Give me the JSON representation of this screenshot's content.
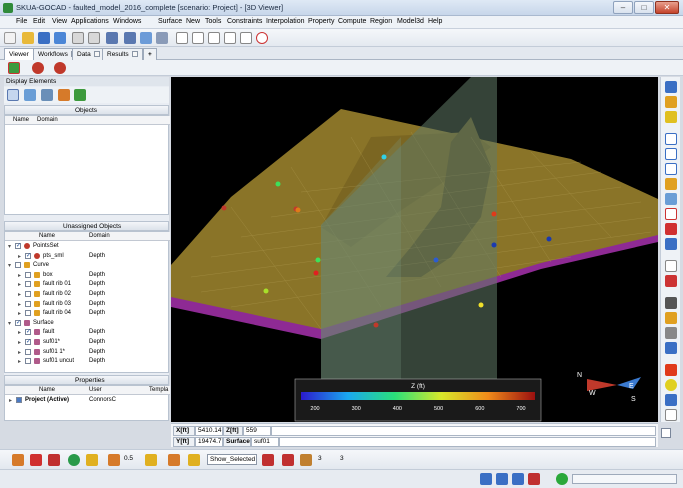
{
  "window": {
    "title": "SKUA-GOCAD - faulted_model_2016_complete  [scenario: Project] - [3D Viewer]",
    "minimize": "–",
    "maximize": "□",
    "close": "✕"
  },
  "menu": [
    "File",
    "Edit",
    "View",
    "Applications",
    "Windows",
    "Surface",
    "New",
    "Tools",
    "Constraints",
    "Interpolation",
    "Property",
    "Compute",
    "Region",
    "Model3d",
    "Help"
  ],
  "tabs": [
    {
      "label": "Viewer",
      "active": true
    },
    {
      "label": "Workflows",
      "active": false
    },
    {
      "label": "Data",
      "active": false
    },
    {
      "label": "Results",
      "active": false
    },
    {
      "label": "+",
      "active": false
    }
  ],
  "left_panel": {
    "title": "Display Elements",
    "objects": {
      "title": "Objects",
      "columns": [
        "Name",
        "Domain"
      ]
    },
    "unassigned": {
      "title": "Unassigned Objects",
      "columns": [
        "Name",
        "Domain"
      ],
      "rows": [
        {
          "name": "PointsSet",
          "domain": "",
          "level": 0,
          "checked": true,
          "icon": "points-icon"
        },
        {
          "name": "pts_sml",
          "domain": "Depth",
          "level": 1,
          "checked": true,
          "icon": "points-icon"
        },
        {
          "name": "Curve",
          "domain": "",
          "level": 0,
          "checked": false,
          "icon": "curve-icon"
        },
        {
          "name": "box",
          "domain": "Depth",
          "level": 1,
          "checked": false,
          "icon": "curve-icon"
        },
        {
          "name": "fault rib 01",
          "domain": "Depth",
          "level": 1,
          "checked": false,
          "icon": "curve-icon"
        },
        {
          "name": "fault rib 02",
          "domain": "Depth",
          "level": 1,
          "checked": false,
          "icon": "curve-icon"
        },
        {
          "name": "fault rib 03",
          "domain": "Depth",
          "level": 1,
          "checked": false,
          "icon": "curve-icon"
        },
        {
          "name": "fault rib 04",
          "domain": "Depth",
          "level": 1,
          "checked": false,
          "icon": "curve-icon"
        },
        {
          "name": "Surface",
          "domain": "",
          "level": 0,
          "checked": true,
          "icon": "surface-icon"
        },
        {
          "name": "fault",
          "domain": "Depth",
          "level": 1,
          "checked": true,
          "icon": "surface-icon"
        },
        {
          "name": "suf01*",
          "domain": "Depth",
          "level": 1,
          "checked": true,
          "icon": "surface-icon"
        },
        {
          "name": "suf01 1*",
          "domain": "Depth",
          "level": 1,
          "checked": false,
          "icon": "surface-icon"
        },
        {
          "name": "suf01 uncut",
          "domain": "Depth",
          "level": 1,
          "checked": false,
          "icon": "surface-icon"
        }
      ]
    },
    "properties": {
      "title": "Properties",
      "columns": [
        "Name",
        "User",
        "Templa"
      ],
      "rows": [
        {
          "name": "Project (Active)",
          "user": "ConnorsC",
          "template": ""
        }
      ]
    }
  },
  "colorbar": {
    "title": "Z (ft)",
    "ticks": [
      "200",
      "300",
      "400",
      "500",
      "600",
      "700"
    ]
  },
  "compass": {
    "n": "N",
    "e": "E",
    "s": "S",
    "w": "W"
  },
  "coords": {
    "x_label": "X[ft]",
    "x_value": "5410.14",
    "y_label": "Y[ft]",
    "y_value": "19474.7",
    "z_label": "Z[ft]",
    "z_value": "559",
    "surface_label": "Surface",
    "surface_value": "suf01"
  },
  "bottom_toolbar": {
    "zoom_value": "0.5",
    "display_mode": "Show_Selected",
    "spin_a": "3",
    "spin_b": "3"
  },
  "colors": {
    "surface": "#8a7428",
    "boundary": "#8e2a94",
    "fault": "#607a66",
    "accent": "#2f8a3a"
  }
}
